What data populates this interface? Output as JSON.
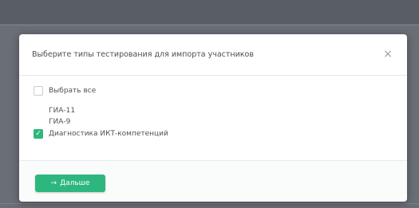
{
  "background": {
    "columns": [
      "",
      "",
      "",
      "",
      "",
      ""
    ],
    "overlay_color": "#5f636a"
  },
  "modal": {
    "title": "Выберите типы тестирования для импорта участников",
    "close_icon": "×",
    "select_all_label": "Выбрать все",
    "options": [
      {
        "label": "ГИА-11",
        "checked": false,
        "has_checkbox": false
      },
      {
        "label": "ГИА-9",
        "checked": false,
        "has_checkbox": false
      },
      {
        "label": "Диагностика ИКТ-компетенций",
        "checked": true,
        "has_checkbox": true
      }
    ],
    "next_button_label": "Дальше",
    "next_button_icon": "→"
  },
  "colors": {
    "accent": "#2db77e",
    "title_text": "#4a4f55",
    "body_text": "#4d5258"
  }
}
